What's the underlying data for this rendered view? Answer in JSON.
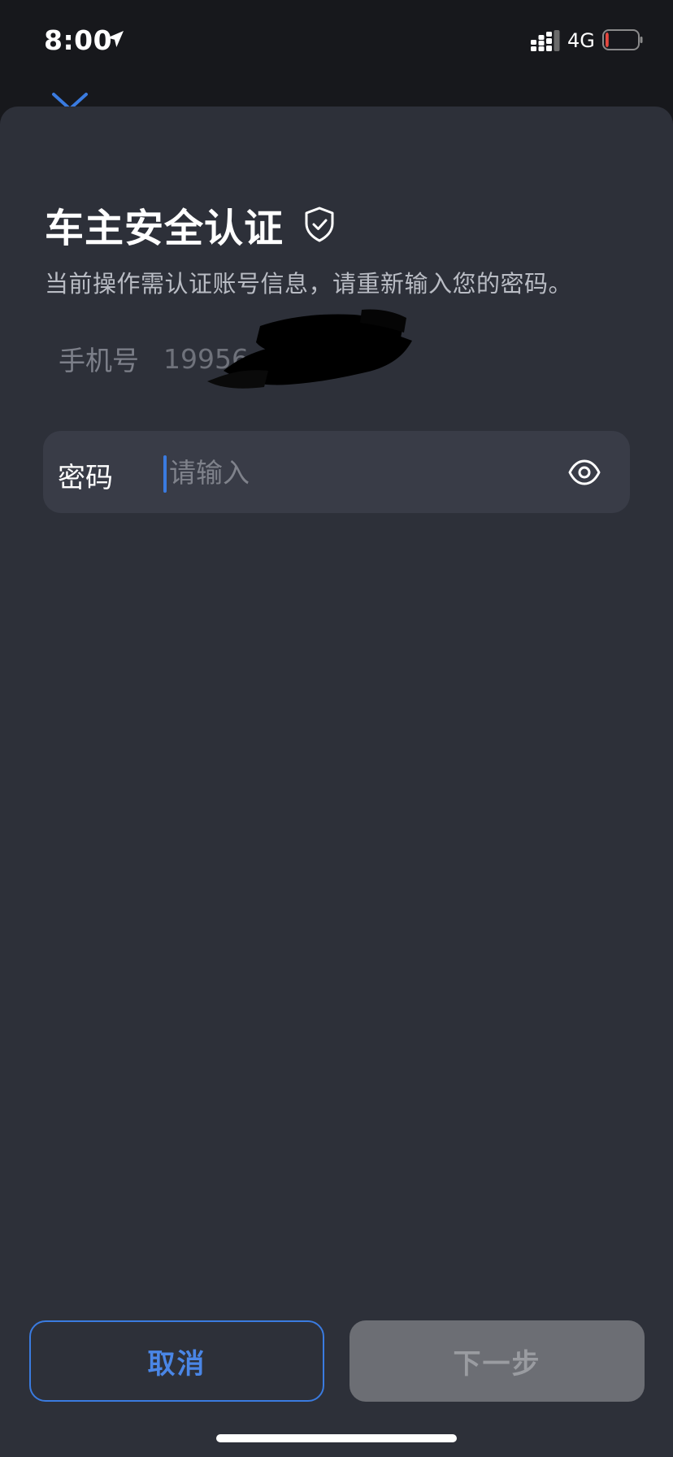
{
  "status_bar": {
    "time": "8:00",
    "network": "4G",
    "battery_level_fraction": 0.1,
    "battery_color": "#e5483f",
    "icons": [
      "location-arrow-icon",
      "signal-icon",
      "battery-icon"
    ]
  },
  "nav": {
    "back_icon": "chevron-down-icon"
  },
  "header": {
    "title": "车主安全认证",
    "title_icon": "shield-check-icon",
    "subtitle": "当前操作需认证账号信息，请重新输入您的密码。"
  },
  "phone": {
    "label": "手机号",
    "value": "19956"
  },
  "password": {
    "label": "密码",
    "placeholder": "请输入",
    "value": "",
    "visibility_icon": "eye-icon"
  },
  "actions": {
    "cancel_label": "取消",
    "next_label": "下一步"
  },
  "colors": {
    "accent": "#3a7be0",
    "sheet_bg": "#2d3039",
    "field_bg": "#393c47",
    "disabled_button_bg": "#6c6e74"
  }
}
